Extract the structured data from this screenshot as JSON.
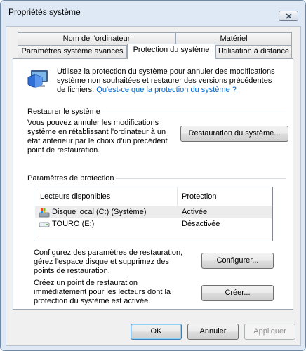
{
  "window": {
    "title": "Propriétés système"
  },
  "tabs_back": [
    "Nom de l'ordinateur",
    "Matériel"
  ],
  "tabs_front": [
    "Paramètres système avancés",
    "Protection du système",
    "Utilisation à distance"
  ],
  "active_tab": "Protection du système",
  "intro": {
    "text": "Utilisez la protection du système pour annuler des modifications système non souhaitées et restaurer des versions précédentes de fichiers.",
    "link": "Qu'est-ce que la protection du système ?"
  },
  "restore": {
    "header": "Restaurer le système",
    "text": "Vous pouvez annuler les modifications système en rétablissant l'ordinateur à un état antérieur par le choix d'un précédent point de restauration.",
    "button": "Restauration du système..."
  },
  "protection": {
    "header": "Paramètres de protection",
    "columns": [
      "Lecteurs disponibles",
      "Protection"
    ],
    "rows": [
      {
        "drive": "Disque local (C:) (Système)",
        "status": "Activée",
        "icon": "system-drive-icon"
      },
      {
        "drive": "TOURO (E:)",
        "status": "Désactivée",
        "icon": "removable-drive-icon"
      }
    ]
  },
  "configure": {
    "text": "Configurez des paramètres de restauration, gérez l'espace disque et supprimez des points de restauration.",
    "button": "Configurer..."
  },
  "create": {
    "text": "Créez un point de restauration immédiatement pour les lecteurs dont la protection du système est activée.",
    "button": "Créer..."
  },
  "footer": {
    "ok": "OK",
    "cancel": "Annuler",
    "apply": "Appliquer"
  },
  "colors": {
    "accent": "#0066cc",
    "frame": "#dfe9f5"
  }
}
